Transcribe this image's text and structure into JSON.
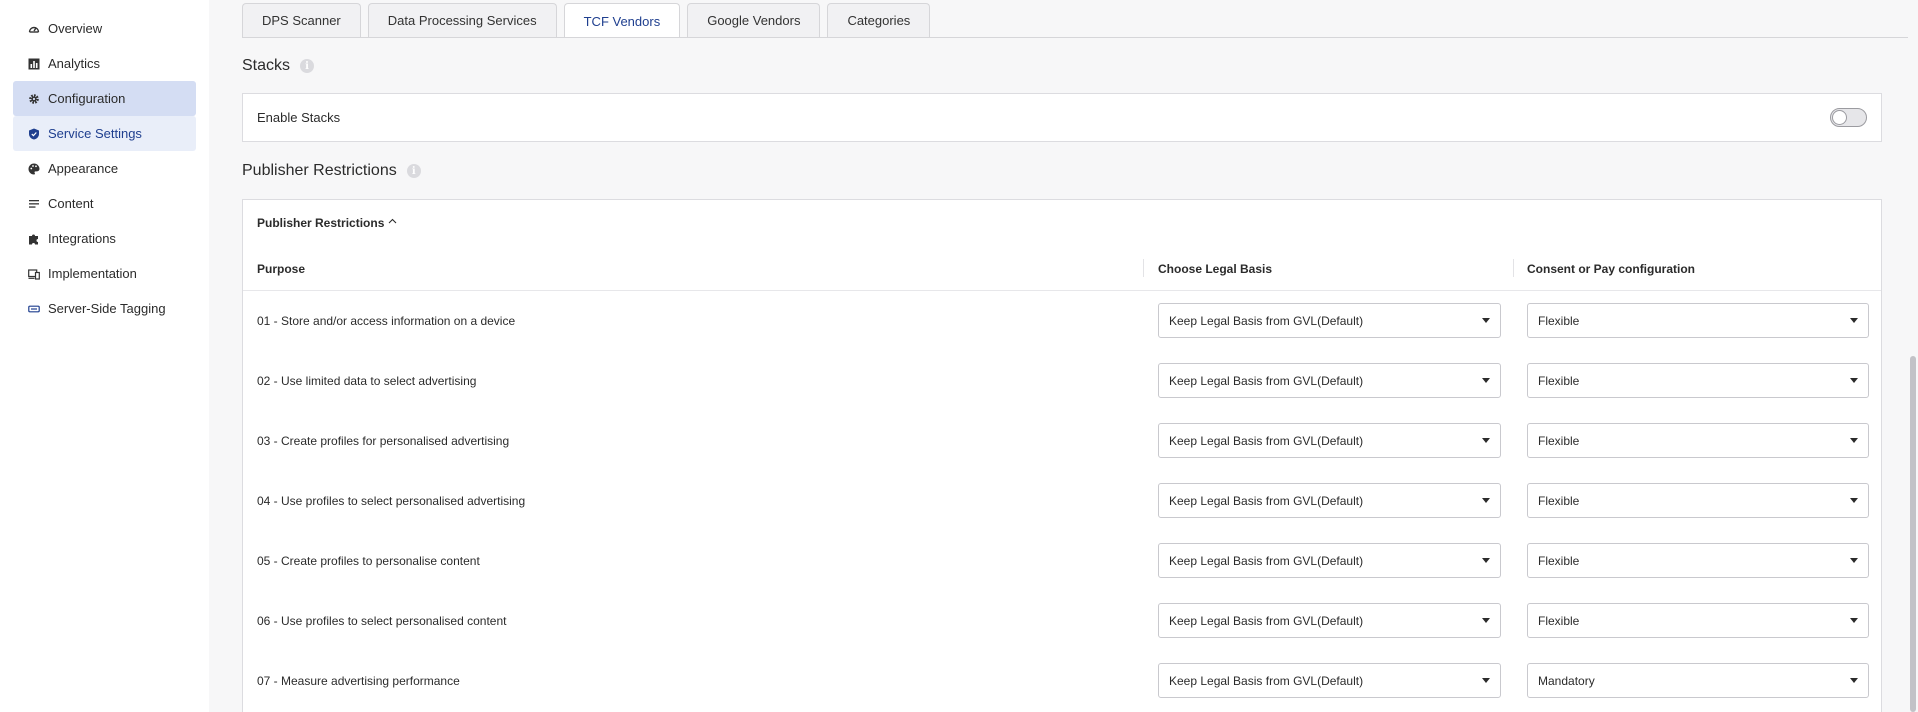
{
  "sidebar": {
    "items": [
      {
        "label": "Overview",
        "icon": "dashboard-icon"
      },
      {
        "label": "Analytics",
        "icon": "bar-chart-icon"
      },
      {
        "label": "Configuration",
        "icon": "gear-icon"
      },
      {
        "label": "Service Settings",
        "icon": "shield-icon"
      },
      {
        "label": "Appearance",
        "icon": "palette-icon"
      },
      {
        "label": "Content",
        "icon": "list-icon"
      },
      {
        "label": "Integrations",
        "icon": "puzzle-icon"
      },
      {
        "label": "Implementation",
        "icon": "devices-icon"
      },
      {
        "label": "Server-Side Tagging",
        "icon": "tag-box-icon"
      }
    ]
  },
  "tabs": [
    {
      "label": "DPS Scanner",
      "active": false
    },
    {
      "label": "Data Processing Services",
      "active": false
    },
    {
      "label": "TCF Vendors",
      "active": true
    },
    {
      "label": "Google Vendors",
      "active": false
    },
    {
      "label": "Categories",
      "active": false
    }
  ],
  "stacks": {
    "title": "Stacks",
    "enable_label": "Enable Stacks",
    "enabled": false
  },
  "publisher_restrictions": {
    "title": "Publisher Restrictions",
    "header": "Publisher Restrictions",
    "columns": {
      "purpose": "Purpose",
      "legal_basis": "Choose Legal Basis",
      "consent_or_pay": "Consent or Pay configuration"
    },
    "rows": [
      {
        "purpose": "01 - Store and/or access information on a device",
        "legal_basis": "Keep Legal Basis from GVL(Default)",
        "consent_or_pay": "Flexible"
      },
      {
        "purpose": "02 - Use limited data to select advertising",
        "legal_basis": "Keep Legal Basis from GVL(Default)",
        "consent_or_pay": "Flexible"
      },
      {
        "purpose": "03 - Create profiles for personalised advertising",
        "legal_basis": "Keep Legal Basis from GVL(Default)",
        "consent_or_pay": "Flexible"
      },
      {
        "purpose": "04 - Use profiles to select personalised advertising",
        "legal_basis": "Keep Legal Basis from GVL(Default)",
        "consent_or_pay": "Flexible"
      },
      {
        "purpose": "05 - Create profiles to personalise content",
        "legal_basis": "Keep Legal Basis from GVL(Default)",
        "consent_or_pay": "Flexible"
      },
      {
        "purpose": "06 - Use profiles to select personalised content",
        "legal_basis": "Keep Legal Basis from GVL(Default)",
        "consent_or_pay": "Flexible"
      },
      {
        "purpose": "07 - Measure advertising performance",
        "legal_basis": "Keep Legal Basis from GVL(Default)",
        "consent_or_pay": "Mandatory"
      }
    ]
  },
  "colors": {
    "accent": "#1f3f8f",
    "active_nav_bg": "#d4ddf3",
    "border": "#dcdce0"
  }
}
